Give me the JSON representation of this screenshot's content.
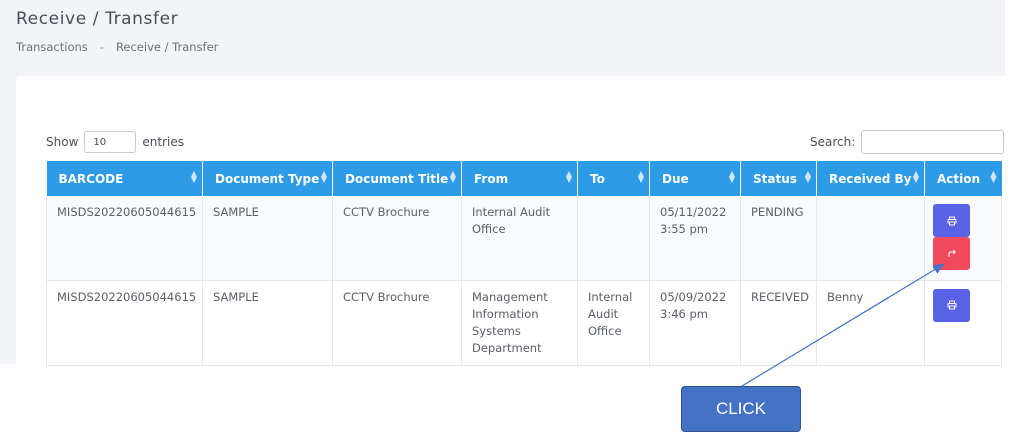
{
  "header": {
    "title": "Receive / Transfer",
    "breadcrumb": [
      "Transactions",
      "-",
      "Receive / Transfer"
    ]
  },
  "controls": {
    "show_label": "Show",
    "show_value": "10",
    "entries_label": "entries",
    "search_label": "Search:"
  },
  "table": {
    "columns": [
      "BARCODE",
      "Document Type",
      "Document Title",
      "From",
      "To",
      "Due",
      "Status",
      "Received By",
      "Action"
    ],
    "rows": [
      {
        "barcode": "MISDS20220605044615",
        "doc_type": "SAMPLE",
        "doc_title": "CCTV Brochure",
        "from": "Internal Audit Office",
        "to": "",
        "due": "05/11/2022 3:55 pm",
        "status": "PENDING",
        "received_by": "",
        "actions": [
          "print-icon",
          "transfer-icon"
        ]
      },
      {
        "barcode": "MISDS20220605044615",
        "doc_type": "SAMPLE",
        "doc_title": "CCTV Brochure",
        "from": "Management Information Systems Department",
        "to": "Internal Audit Office",
        "due": "05/09/2022 3:46 pm",
        "status": "RECEIVED",
        "received_by": "Benny",
        "actions": [
          "print-icon"
        ]
      }
    ]
  },
  "annotation": {
    "label": "CLICK"
  },
  "colors": {
    "header_bg": "#2d9be6",
    "print_button": "#5a62e6",
    "transfer_button": "#f2495a",
    "callout": "#4472c4"
  }
}
